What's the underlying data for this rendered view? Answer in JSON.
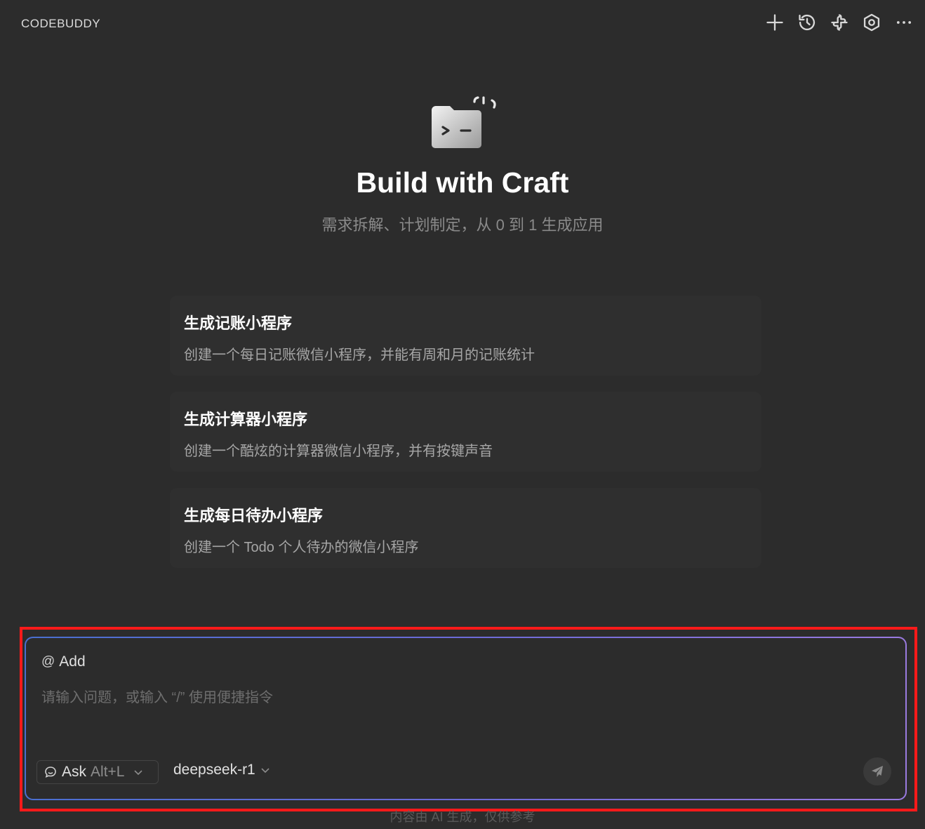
{
  "header": {
    "title": "CODEBUDDY",
    "toolbar": [
      {
        "icon": "plus-icon"
      },
      {
        "icon": "history-icon"
      },
      {
        "icon": "plugin-icon"
      },
      {
        "icon": "settings-icon"
      },
      {
        "icon": "more-icon"
      }
    ]
  },
  "hero": {
    "icon": "terminal-folder-icon",
    "title": "Build with Craft",
    "subtitle": "需求拆解、计划制定，从 0 到 1 生成应用"
  },
  "cards": [
    {
      "title": "生成记账小程序",
      "desc": "创建一个每日记账微信小程序，并能有周和月的记账统计"
    },
    {
      "title": "生成计算器小程序",
      "desc": "创建一个酷炫的计算器微信小程序，并有按键声音"
    },
    {
      "title": "生成每日待办小程序",
      "desc": "创建一个 Todo 个人待办的微信小程序"
    }
  ],
  "composer": {
    "add_label": "Add",
    "placeholder": "请输入问题，或输入 “/” 使用便捷指令",
    "mode": {
      "label": "Ask",
      "shortcut": "Alt+L"
    },
    "model": "deepseek-r1",
    "send_icon": "send-icon"
  },
  "footer_note": "内容由 AI 生成，仅供参考",
  "colors": {
    "background": "#2c2c2c",
    "highlight": "#ff1a1a",
    "gradient_start": "#4a6fd0",
    "gradient_end": "#9a7ae0"
  }
}
